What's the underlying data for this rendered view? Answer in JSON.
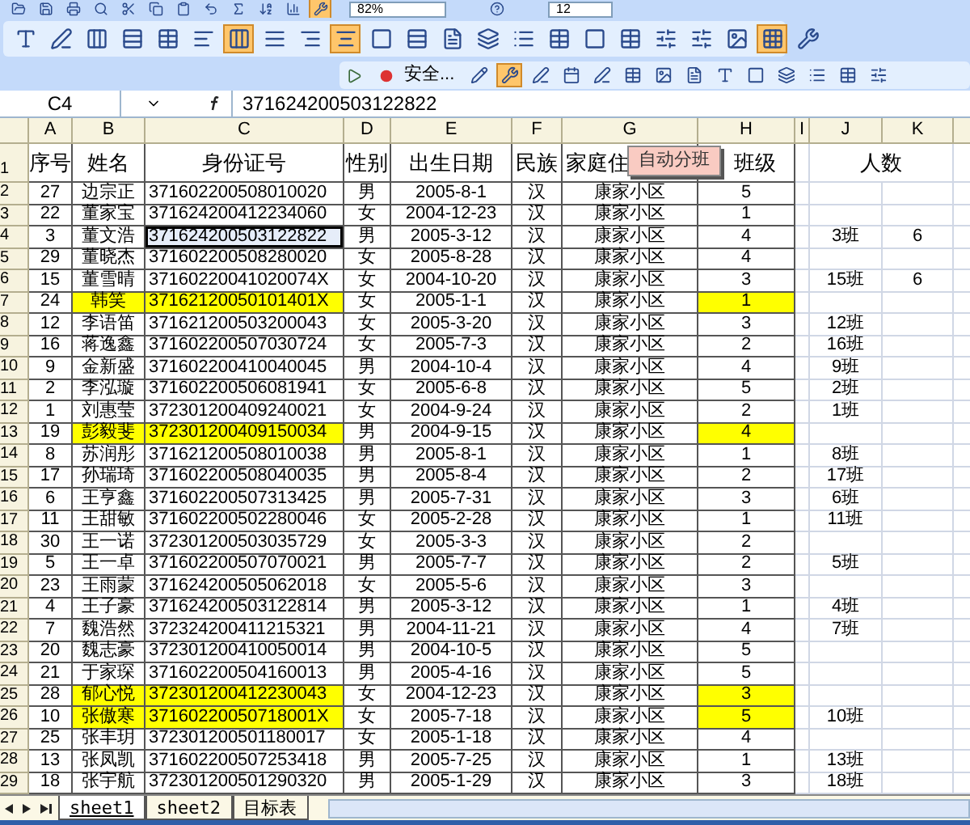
{
  "toolbar_1": {
    "buttons": [
      {
        "pressed": false
      },
      {
        "pressed": false
      },
      {
        "pressed": false
      },
      {
        "pressed": false
      },
      {
        "pressed": false
      },
      {
        "pressed": false
      },
      {
        "pressed": false
      },
      {
        "pressed": false
      },
      {
        "pressed": false
      },
      {
        "pressed": false
      },
      {
        "pressed": false
      },
      {
        "pressed": true
      }
    ],
    "zoom": "82%",
    "font_size": "12"
  },
  "toolbar_2": {
    "buttons": [
      {
        "pressed": false
      },
      {
        "pressed": false
      },
      {
        "pressed": false
      },
      {
        "pressed": false
      },
      {
        "pressed": false
      },
      {
        "pressed": false
      },
      {
        "pressed": true
      },
      {
        "pressed": false
      },
      {
        "pressed": false
      },
      {
        "pressed": true
      },
      {
        "pressed": false
      },
      {
        "pressed": false
      },
      {
        "pressed": false
      },
      {
        "pressed": false
      },
      {
        "pressed": false
      },
      {
        "pressed": false
      },
      {
        "pressed": false
      },
      {
        "pressed": false
      },
      {
        "pressed": false
      },
      {
        "pressed": false
      },
      {
        "pressed": false
      },
      {
        "pressed": true
      },
      {
        "pressed": false
      }
    ]
  },
  "toolbar_3": {
    "security_button": "安全...",
    "buttons": [
      {
        "pressed": false
      },
      {
        "pressed": true
      },
      {
        "pressed": false
      },
      {
        "pressed": false
      },
      {
        "pressed": false
      },
      {
        "pressed": false
      },
      {
        "pressed": false
      },
      {
        "pressed": false
      },
      {
        "pressed": false
      },
      {
        "pressed": false
      },
      {
        "pressed": false
      },
      {
        "pressed": false
      },
      {
        "pressed": false
      },
      {
        "pressed": false
      }
    ]
  },
  "formula_bar": {
    "name_box": "C4",
    "value": "371624200503122822"
  },
  "columns": [
    "A",
    "B",
    "C",
    "D",
    "E",
    "F",
    "G",
    "H",
    "I",
    "J",
    "K"
  ],
  "header_row": {
    "row_number": "1",
    "cells": [
      "序号",
      "姓名",
      "身份证号",
      "性别",
      "出生日期",
      "民族",
      "家庭住",
      "班级"
    ],
    "count_header": "人数"
  },
  "overlay_button": "自动分班",
  "rows": [
    {
      "row_number": "2",
      "cells": [
        "27",
        "边宗正",
        "371602200508010020",
        "男",
        "2005-8-1",
        "汉",
        "康家小区",
        "5"
      ],
      "highlighted": false,
      "selected": false
    },
    {
      "row_number": "3",
      "cells": [
        "22",
        "董家宝",
        "371624200412234060",
        "女",
        "2004-12-23",
        "汉",
        "康家小区",
        "1"
      ],
      "highlighted": false,
      "selected": false
    },
    {
      "row_number": "4",
      "cells": [
        "3",
        "董文浩",
        "371624200503122822",
        "男",
        "2005-3-12",
        "汉",
        "康家小区",
        "4"
      ],
      "highlighted": false,
      "selected": true,
      "class": "3班",
      "count": "6"
    },
    {
      "row_number": "5",
      "cells": [
        "29",
        "董晓杰",
        "371602200508280020",
        "女",
        "2005-8-28",
        "汉",
        "康家小区",
        "4"
      ],
      "highlighted": false,
      "selected": false
    },
    {
      "row_number": "6",
      "cells": [
        "15",
        "董雪晴",
        "37160220041020074X",
        "女",
        "2004-10-20",
        "汉",
        "康家小区",
        "3"
      ],
      "highlighted": false,
      "selected": false,
      "class": "15班",
      "count": "6"
    },
    {
      "row_number": "7",
      "cells": [
        "24",
        "韩笑",
        "37162120050101401X",
        "女",
        "2005-1-1",
        "汉",
        "康家小区",
        "1"
      ],
      "highlighted": true,
      "selected": false
    },
    {
      "row_number": "8",
      "cells": [
        "12",
        "李语笛",
        "371621200503200043",
        "女",
        "2005-3-20",
        "汉",
        "康家小区",
        "3"
      ],
      "highlighted": false,
      "selected": false,
      "class": "12班"
    },
    {
      "row_number": "9",
      "cells": [
        "16",
        "蒋逸鑫",
        "371602200507030724",
        "女",
        "2005-7-3",
        "汉",
        "康家小区",
        "2"
      ],
      "highlighted": false,
      "selected": false,
      "class": "16班"
    },
    {
      "row_number": "10",
      "cells": [
        "9",
        "金新盛",
        "371602200410040045",
        "男",
        "2004-10-4",
        "汉",
        "康家小区",
        "4"
      ],
      "highlighted": false,
      "selected": false,
      "class": "9班"
    },
    {
      "row_number": "11",
      "cells": [
        "2",
        "李泓璇",
        "371602200506081941",
        "女",
        "2005-6-8",
        "汉",
        "康家小区",
        "5"
      ],
      "highlighted": false,
      "selected": false,
      "class": "2班"
    },
    {
      "row_number": "12",
      "cells": [
        "1",
        "刘惠莹",
        "372301200409240021",
        "女",
        "2004-9-24",
        "汉",
        "康家小区",
        "2"
      ],
      "highlighted": false,
      "selected": false,
      "class": "1班"
    },
    {
      "row_number": "13",
      "cells": [
        "19",
        "彭毅斐",
        "372301200409150034",
        "男",
        "2004-9-15",
        "汉",
        "康家小区",
        "4"
      ],
      "highlighted": true,
      "selected": false
    },
    {
      "row_number": "14",
      "cells": [
        "8",
        "苏润彤",
        "371621200508010038",
        "男",
        "2005-8-1",
        "汉",
        "康家小区",
        "1"
      ],
      "highlighted": false,
      "selected": false,
      "class": "8班"
    },
    {
      "row_number": "15",
      "cells": [
        "17",
        "孙瑞琦",
        "371602200508040035",
        "男",
        "2005-8-4",
        "汉",
        "康家小区",
        "2"
      ],
      "highlighted": false,
      "selected": false,
      "class": "17班"
    },
    {
      "row_number": "16",
      "cells": [
        "6",
        "王亨鑫",
        "371602200507313425",
        "男",
        "2005-7-31",
        "汉",
        "康家小区",
        "3"
      ],
      "highlighted": false,
      "selected": false,
      "class": "6班"
    },
    {
      "row_number": "17",
      "cells": [
        "11",
        "王甜敏",
        "371602200502280046",
        "女",
        "2005-2-28",
        "汉",
        "康家小区",
        "1"
      ],
      "highlighted": false,
      "selected": false,
      "class": "11班"
    },
    {
      "row_number": "18",
      "cells": [
        "30",
        "王一诺",
        "372301200503035729",
        "女",
        "2005-3-3",
        "汉",
        "康家小区",
        "2"
      ],
      "highlighted": false,
      "selected": false
    },
    {
      "row_number": "19",
      "cells": [
        "5",
        "王一卓",
        "371602200507070021",
        "男",
        "2005-7-7",
        "汉",
        "康家小区",
        "2"
      ],
      "highlighted": false,
      "selected": false,
      "class": "5班"
    },
    {
      "row_number": "20",
      "cells": [
        "23",
        "王雨蒙",
        "371624200505062018",
        "女",
        "2005-5-6",
        "汉",
        "康家小区",
        "3"
      ],
      "highlighted": false,
      "selected": false
    },
    {
      "row_number": "21",
      "cells": [
        "4",
        "王子豪",
        "371624200503122814",
        "男",
        "2005-3-12",
        "汉",
        "康家小区",
        "1"
      ],
      "highlighted": false,
      "selected": false,
      "class": "4班"
    },
    {
      "row_number": "22",
      "cells": [
        "7",
        "魏浩然",
        "372324200411215321",
        "男",
        "2004-11-21",
        "汉",
        "康家小区",
        "4"
      ],
      "highlighted": false,
      "selected": false,
      "class": "7班"
    },
    {
      "row_number": "23",
      "cells": [
        "20",
        "魏志豪",
        "372301200410050014",
        "男",
        "2004-10-5",
        "汉",
        "康家小区",
        "5"
      ],
      "highlighted": false,
      "selected": false
    },
    {
      "row_number": "24",
      "cells": [
        "21",
        "于家琛",
        "371602200504160013",
        "男",
        "2005-4-16",
        "汉",
        "康家小区",
        "5"
      ],
      "highlighted": false,
      "selected": false
    },
    {
      "row_number": "25",
      "cells": [
        "28",
        "郁心悦",
        "372301200412230043",
        "女",
        "2004-12-23",
        "汉",
        "康家小区",
        "3"
      ],
      "highlighted": true,
      "selected": false
    },
    {
      "row_number": "26",
      "cells": [
        "10",
        "张傲寒",
        "37160220050718001X",
        "女",
        "2005-7-18",
        "汉",
        "康家小区",
        "5"
      ],
      "highlighted": true,
      "selected": false,
      "class": "10班"
    },
    {
      "row_number": "27",
      "cells": [
        "25",
        "张丰玥",
        "372301200501180017",
        "女",
        "2005-1-18",
        "汉",
        "康家小区",
        "4"
      ],
      "highlighted": false,
      "selected": false
    },
    {
      "row_number": "28",
      "cells": [
        "13",
        "张凤凯",
        "371602200507253418",
        "男",
        "2005-7-25",
        "汉",
        "康家小区",
        "1"
      ],
      "highlighted": false,
      "selected": false,
      "class": "13班"
    },
    {
      "row_number": "29",
      "cells": [
        "18",
        "张宇航",
        "372301200501290320",
        "男",
        "2005-1-29",
        "汉",
        "康家小区",
        "3"
      ],
      "highlighted": false,
      "selected": false,
      "class": "18班"
    }
  ],
  "sheet_tabs": [
    {
      "label": "sheet1",
      "selected": true
    },
    {
      "label": "sheet2",
      "selected": false
    },
    {
      "label": "目标表",
      "selected": false
    }
  ]
}
